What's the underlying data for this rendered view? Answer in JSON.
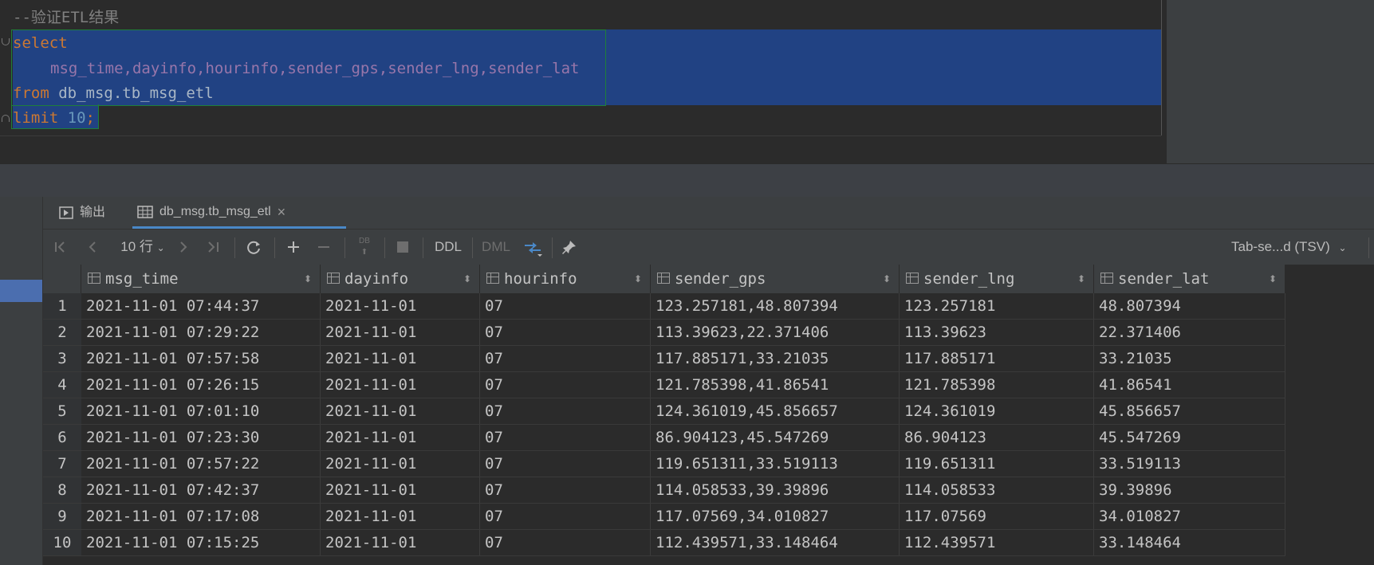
{
  "editor": {
    "comment": "--验证ETL结果",
    "kw_select": "select",
    "columns_line": "msg_time,dayinfo,hourinfo,sender_gps,sender_lng,sender_lat",
    "kw_from": "from",
    "table_ref": "db_msg.tb_msg_etl",
    "kw_limit": "limit",
    "limit_value": "10",
    "semicolon": ";"
  },
  "tabs": [
    {
      "label": "输出",
      "icon": "console-output-icon"
    },
    {
      "label": "db_msg.tb_msg_etl",
      "icon": "table-grid-icon",
      "close": "×"
    }
  ],
  "toolbar": {
    "page_size": "10 行",
    "ddl": "DDL",
    "dml": "DML",
    "db_badge": "DB",
    "export_format": "Tab-se...d (TSV)"
  },
  "grid": {
    "columns": [
      "msg_time",
      "dayinfo",
      "hourinfo",
      "sender_gps",
      "sender_lng",
      "sender_lat"
    ],
    "rows": [
      [
        "1",
        "2021-11-01 07:44:37",
        "2021-11-01",
        "07",
        "123.257181,48.807394",
        "123.257181",
        "48.807394"
      ],
      [
        "2",
        "2021-11-01 07:29:22",
        "2021-11-01",
        "07",
        "113.39623,22.371406",
        "113.39623",
        "22.371406"
      ],
      [
        "3",
        "2021-11-01 07:57:58",
        "2021-11-01",
        "07",
        "117.885171,33.21035",
        "117.885171",
        "33.21035"
      ],
      [
        "4",
        "2021-11-01 07:26:15",
        "2021-11-01",
        "07",
        "121.785398,41.86541",
        "121.785398",
        "41.86541"
      ],
      [
        "5",
        "2021-11-01 07:01:10",
        "2021-11-01",
        "07",
        "124.361019,45.856657",
        "124.361019",
        "45.856657"
      ],
      [
        "6",
        "2021-11-01 07:23:30",
        "2021-11-01",
        "07",
        "86.904123,45.547269",
        "86.904123",
        "45.547269"
      ],
      [
        "7",
        "2021-11-01 07:57:22",
        "2021-11-01",
        "07",
        "119.651311,33.519113",
        "119.651311",
        "33.519113"
      ],
      [
        "8",
        "2021-11-01 07:42:37",
        "2021-11-01",
        "07",
        "114.058533,39.39896",
        "114.058533",
        "39.39896"
      ],
      [
        "9",
        "2021-11-01 07:17:08",
        "2021-11-01",
        "07",
        "117.07569,34.010827",
        "117.07569",
        "34.010827"
      ],
      [
        "10",
        "2021-11-01 07:15:25",
        "2021-11-01",
        "07",
        "112.439571,33.148464",
        "112.439571",
        "33.148464"
      ]
    ]
  },
  "colors": {
    "keyword": "#cc7832",
    "field": "#9876aa",
    "number": "#6897bb",
    "selection": "#214283",
    "accent": "#4a88c7"
  }
}
